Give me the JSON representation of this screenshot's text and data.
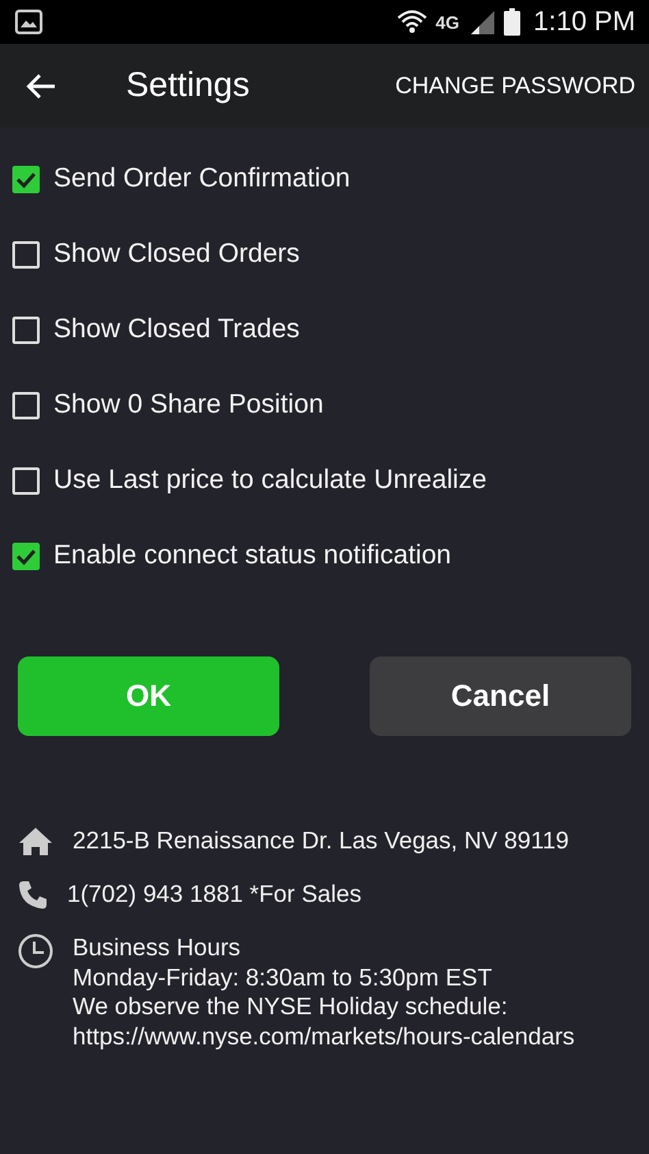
{
  "status_bar": {
    "network": "4G",
    "time": "1:10 PM"
  },
  "app_bar": {
    "title": "Settings",
    "action": "CHANGE PASSWORD"
  },
  "options": [
    {
      "label": "Send Order Confirmation",
      "checked": true
    },
    {
      "label": "Show Closed Orders",
      "checked": false
    },
    {
      "label": "Show Closed Trades",
      "checked": false
    },
    {
      "label": "Show 0 Share Position",
      "checked": false
    },
    {
      "label": "Use Last price to calculate Unrealize",
      "checked": false
    },
    {
      "label": "Enable connect status notification",
      "checked": true
    }
  ],
  "buttons": [
    {
      "label": "OK",
      "kind": "primary"
    },
    {
      "label": "Cancel",
      "kind": "secondary"
    }
  ],
  "contact": [
    {
      "kind": "address",
      "lines": [
        "2215-B Renaissance Dr. Las Vegas, NV 89119"
      ]
    },
    {
      "kind": "phone",
      "lines": [
        "1(702) 943 1881 *For Sales"
      ]
    },
    {
      "kind": "hours",
      "lines": [
        "Business Hours",
        "Monday-Friday: 8:30am to 5:30pm EST",
        "We observe the NYSE Holiday schedule:",
        "https://www.nyse.com/markets/hours-calendars"
      ]
    }
  ]
}
